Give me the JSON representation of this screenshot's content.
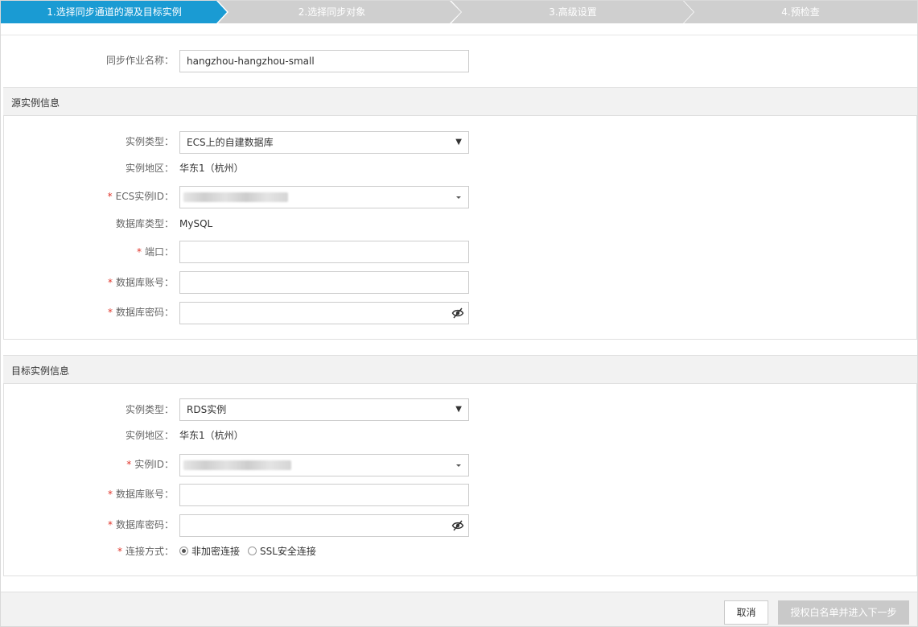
{
  "steps": [
    {
      "label": "1.选择同步通道的源及目标实例",
      "active": true
    },
    {
      "label": "2.选择同步对象",
      "active": false
    },
    {
      "label": "3.高级设置",
      "active": false
    },
    {
      "label": "4.预检查",
      "active": false
    }
  ],
  "colors": {
    "active_step": "#1a9bd3",
    "inactive_step": "#cfcfcf",
    "required": "#e0342a"
  },
  "job": {
    "name_label": "同步作业名称：",
    "name_value": "hangzhou-hangzhou-small"
  },
  "source": {
    "title": "源实例信息",
    "instance_type_label": "实例类型：",
    "instance_type_value": "ECS上的自建数据库",
    "region_label": "实例地区：",
    "region_value": "华东1（杭州）",
    "ecs_id_label": "ECS实例ID：",
    "db_type_label": "数据库类型：",
    "db_type_value": "MySQL",
    "port_label": "端口：",
    "account_label": "数据库账号：",
    "password_label": "数据库密码："
  },
  "target": {
    "title": "目标实例信息",
    "instance_type_label": "实例类型：",
    "instance_type_value": "RDS实例",
    "region_label": "实例地区：",
    "region_value": "华东1（杭州）",
    "instance_id_label": "实例ID：",
    "account_label": "数据库账号：",
    "password_label": "数据库密码：",
    "connection_label": "连接方式：",
    "connection_options": [
      "非加密连接",
      "SSL安全连接"
    ]
  },
  "footer": {
    "cancel_label": "取消",
    "next_label": "授权白名单并进入下一步"
  },
  "required_mark": "*",
  "icons": {
    "select_arrow": "▼",
    "password_toggle": "eye-off-icon"
  }
}
